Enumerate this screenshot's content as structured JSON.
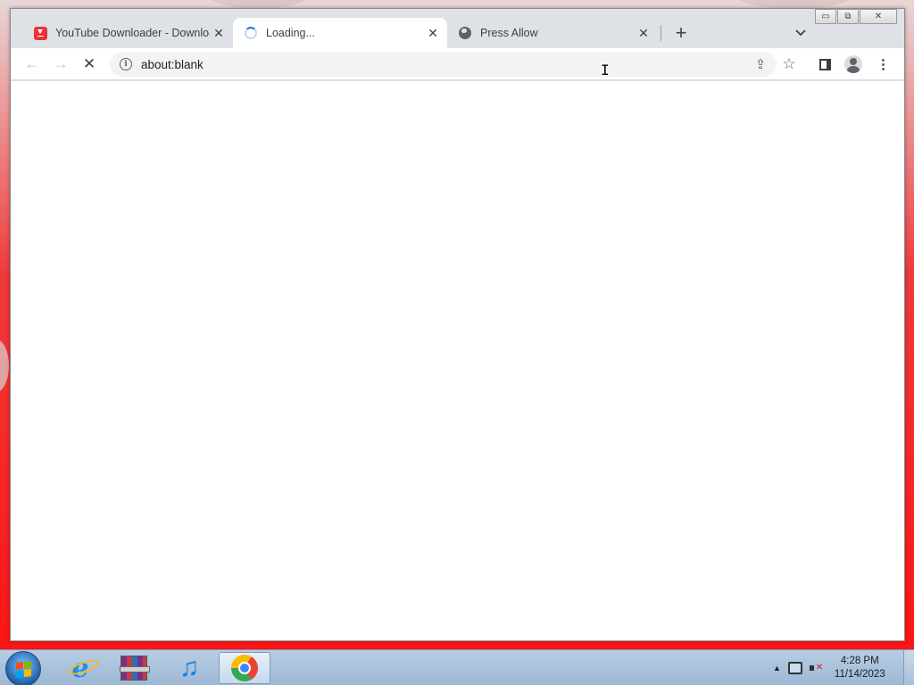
{
  "browser": {
    "tabs": [
      {
        "title": "YouTube Downloader - Download",
        "favicon": "download-icon",
        "active": false
      },
      {
        "title": "Loading...",
        "favicon": "spinner-icon",
        "active": true
      },
      {
        "title": "Press Allow",
        "favicon": "globe-icon",
        "active": false
      }
    ],
    "new_tab_label": "+",
    "tab_search_label": "⌄",
    "window_controls": {
      "minimize": "▭",
      "restore": "⧉",
      "close": "✕"
    },
    "toolbar": {
      "back_icon": "←",
      "forward_icon": "→",
      "stop_icon": "✕",
      "url": "about:blank",
      "share_icon": "⇪",
      "bookmark_icon": "☆"
    }
  },
  "taskbar": {
    "apps": [
      "internet-explorer",
      "winrar",
      "itunes",
      "chrome"
    ],
    "tray_arrow": "▲",
    "clock": {
      "time": "4:28 PM",
      "date": "11/14/2023"
    }
  },
  "colors": {
    "tabstrip": "#dee1e6",
    "accent": "#1a73e8",
    "desktop_red": "#ff1111"
  }
}
